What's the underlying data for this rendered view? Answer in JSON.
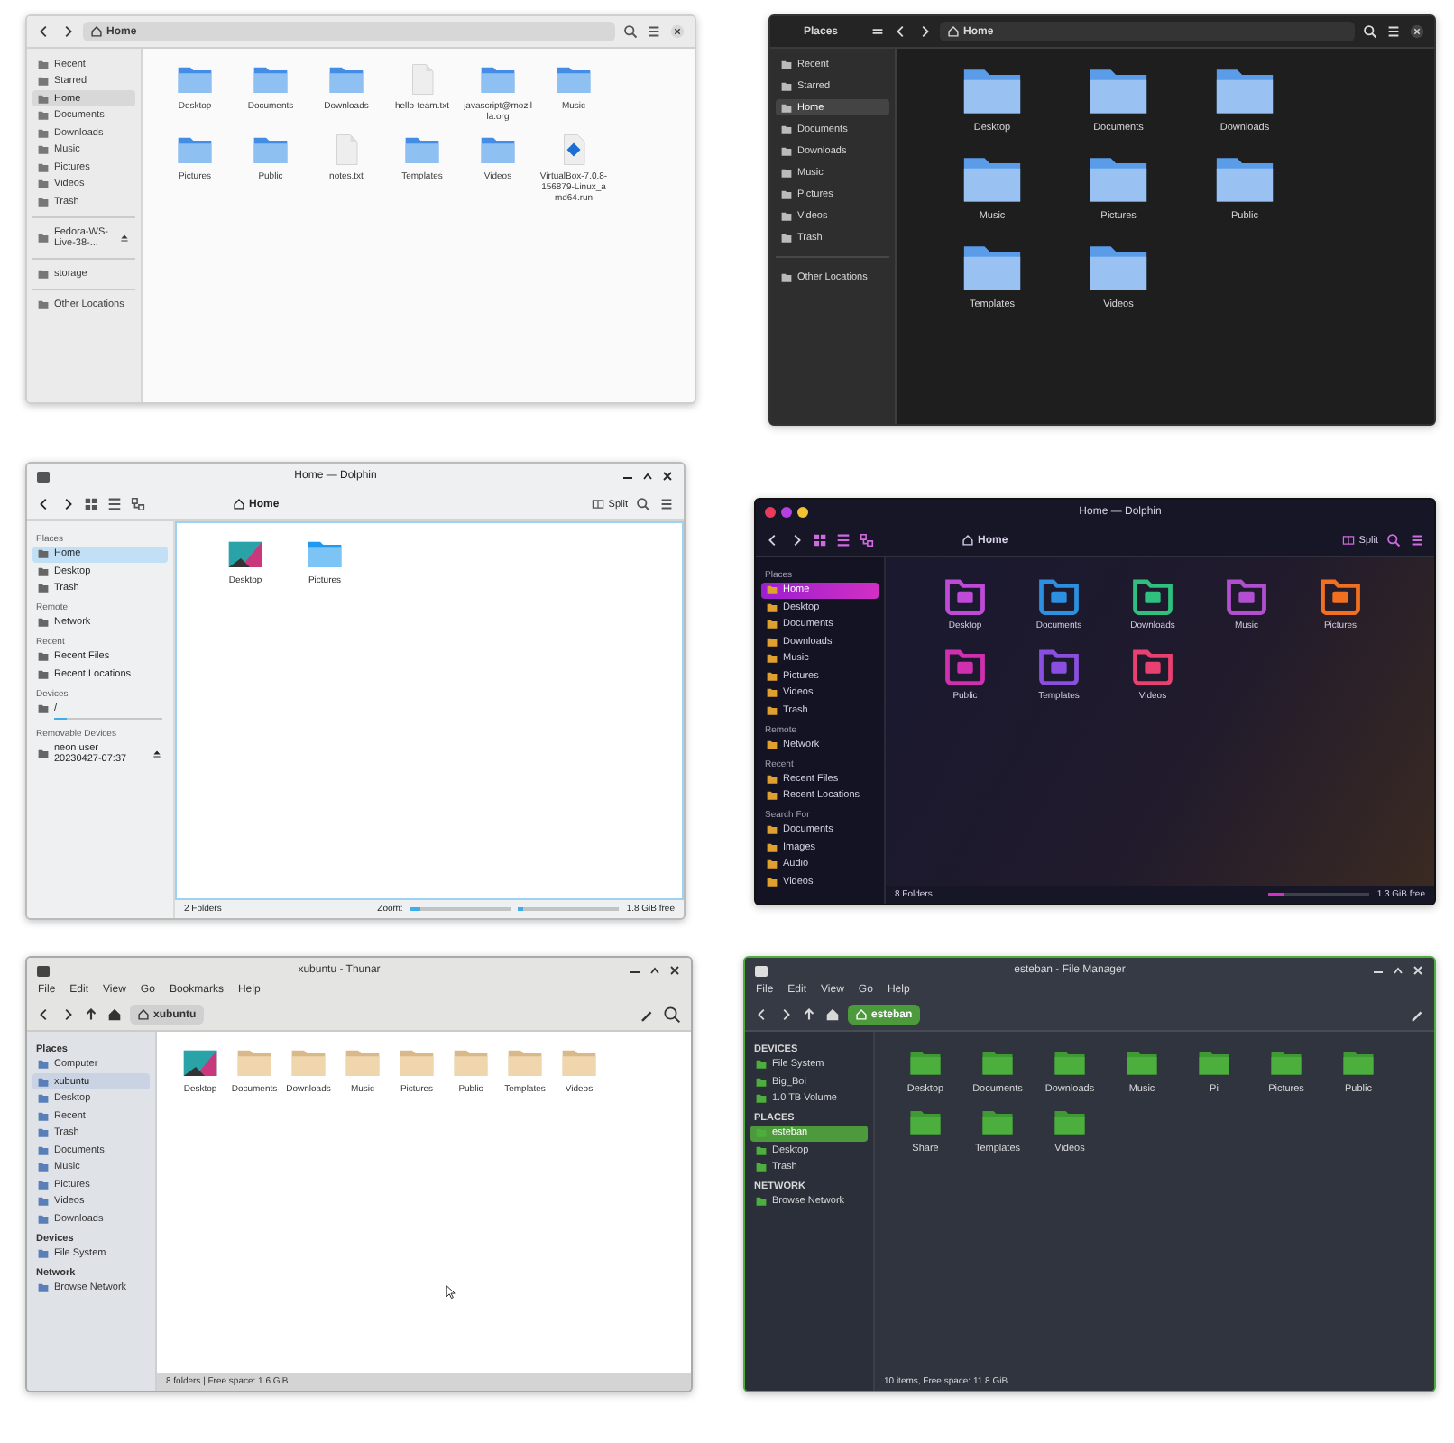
{
  "windows": [
    {
      "kind": "gnome-light",
      "path": "Home",
      "sidebar": [
        {
          "items": [
            {
              "label": "Recent",
              "selected": false
            },
            {
              "label": "Starred",
              "selected": false
            },
            {
              "label": "Home",
              "selected": true
            },
            {
              "label": "Documents",
              "selected": false
            },
            {
              "label": "Downloads",
              "selected": false
            },
            {
              "label": "Music",
              "selected": false
            },
            {
              "label": "Pictures",
              "selected": false
            },
            {
              "label": "Videos",
              "selected": false
            },
            {
              "label": "Trash",
              "selected": false
            }
          ]
        },
        {
          "items": [
            {
              "label": "Fedora-WS-Live-38-...",
              "selected": false,
              "eject": true
            }
          ]
        },
        {
          "items": [
            {
              "label": "storage",
              "selected": false
            }
          ]
        },
        {
          "items": [
            {
              "label": "Other Locations",
              "selected": false
            }
          ]
        }
      ],
      "files": [
        {
          "name": "Desktop",
          "kind": "folder"
        },
        {
          "name": "Documents",
          "kind": "folder"
        },
        {
          "name": "Downloads",
          "kind": "folder"
        },
        {
          "name": "hello-team.txt",
          "kind": "text"
        },
        {
          "name": "javascript@mozilla.org",
          "kind": "folder"
        },
        {
          "name": "Music",
          "kind": "folder"
        },
        {
          "name": "Pictures",
          "kind": "folder"
        },
        {
          "name": "Public",
          "kind": "folder"
        },
        {
          "name": "notes.txt",
          "kind": "text"
        },
        {
          "name": "Templates",
          "kind": "folder"
        },
        {
          "name": "Videos",
          "kind": "folder"
        },
        {
          "name": "VirtualBox-7.0.8-156879-Linux_amd64.run",
          "kind": "package"
        }
      ]
    },
    {
      "kind": "gnome-dark",
      "sidebar_title": "Places",
      "path": "Home",
      "sidebar": [
        {
          "items": [
            {
              "label": "Recent",
              "selected": false
            },
            {
              "label": "Starred",
              "selected": false
            },
            {
              "label": "Home",
              "selected": true
            },
            {
              "label": "Documents",
              "selected": false
            },
            {
              "label": "Downloads",
              "selected": false
            },
            {
              "label": "Music",
              "selected": false
            },
            {
              "label": "Pictures",
              "selected": false
            },
            {
              "label": "Videos",
              "selected": false
            },
            {
              "label": "Trash",
              "selected": false
            }
          ]
        },
        {
          "items": [
            {
              "label": "Other Locations",
              "selected": false
            }
          ]
        }
      ],
      "files": [
        {
          "name": "Desktop",
          "kind": "folder"
        },
        {
          "name": "Documents",
          "kind": "folder"
        },
        {
          "name": "Downloads",
          "kind": "folder"
        },
        {
          "name": "Music",
          "kind": "folder"
        },
        {
          "name": "Pictures",
          "kind": "folder"
        },
        {
          "name": "Public",
          "kind": "folder"
        },
        {
          "name": "Templates",
          "kind": "folder"
        },
        {
          "name": "Videos",
          "kind": "folder"
        }
      ]
    },
    {
      "kind": "dolphin-light",
      "title": "Home — Dolphin",
      "path": "Home",
      "split": "Split",
      "sidebar": [
        {
          "heading": "Places",
          "items": [
            {
              "label": "Home",
              "selected": true
            },
            {
              "label": "Desktop",
              "selected": false
            },
            {
              "label": "Trash",
              "selected": false
            }
          ]
        },
        {
          "heading": "Remote",
          "items": [
            {
              "label": "Network",
              "selected": false
            }
          ]
        },
        {
          "heading": "Recent",
          "items": [
            {
              "label": "Recent Files",
              "selected": false
            },
            {
              "label": "Recent Locations",
              "selected": false
            }
          ]
        },
        {
          "heading": "Devices",
          "items": [
            {
              "label": "/",
              "selected": false,
              "level": 0.12
            }
          ]
        },
        {
          "heading": "Removable Devices",
          "items": [
            {
              "label": "neon user 20230427-07:37",
              "selected": false,
              "eject": true
            }
          ]
        }
      ],
      "files": [
        {
          "name": "Desktop",
          "kind": "image"
        },
        {
          "name": "Pictures",
          "kind": "folder"
        }
      ],
      "status": "2 Folders",
      "zoom": {
        "label": "Zoom:",
        "level": 0.1
      },
      "free_space": {
        "text": "1.8 GiB free",
        "level": 0.05
      }
    },
    {
      "kind": "dolphin-neon",
      "title": "Home — Dolphin",
      "path": "Home",
      "split": "Split",
      "sidebar": [
        {
          "heading": "Places",
          "items": [
            {
              "label": "Home",
              "selected": true
            },
            {
              "label": "Desktop",
              "selected": false
            },
            {
              "label": "Documents",
              "selected": false
            },
            {
              "label": "Downloads",
              "selected": false
            },
            {
              "label": "Music",
              "selected": false
            },
            {
              "label": "Pictures",
              "selected": false
            },
            {
              "label": "Videos",
              "selected": false
            },
            {
              "label": "Trash",
              "selected": false
            }
          ]
        },
        {
          "heading": "Remote",
          "items": [
            {
              "label": "Network",
              "selected": false
            }
          ]
        },
        {
          "heading": "Recent",
          "items": [
            {
              "label": "Recent Files",
              "selected": false
            },
            {
              "label": "Recent Locations",
              "selected": false
            }
          ]
        },
        {
          "heading": "Search For",
          "items": [
            {
              "label": "Documents",
              "selected": false
            },
            {
              "label": "Images",
              "selected": false
            },
            {
              "label": "Audio",
              "selected": false
            },
            {
              "label": "Videos",
              "selected": false
            }
          ]
        }
      ],
      "files": [
        {
          "name": "Desktop",
          "kind": "folder",
          "color": "#c04ad8"
        },
        {
          "name": "Documents",
          "kind": "folder",
          "color": "#2c8fe0"
        },
        {
          "name": "Downloads",
          "kind": "folder",
          "color": "#2fbf7f"
        },
        {
          "name": "Music",
          "kind": "folder",
          "color": "#b24fd0"
        },
        {
          "name": "Pictures",
          "kind": "folder",
          "color": "#f07020"
        },
        {
          "name": "Public",
          "kind": "folder",
          "color": "#d030b0"
        },
        {
          "name": "Templates",
          "kind": "folder",
          "color": "#8a4fe0"
        },
        {
          "name": "Videos",
          "kind": "folder",
          "color": "#e84070"
        }
      ],
      "status": "8 Folders",
      "free_space": {
        "text": "1.3 GiB free",
        "level": 0.15
      }
    },
    {
      "kind": "thunar",
      "title": "xubuntu - Thunar",
      "menu": [
        "File",
        "Edit",
        "View",
        "Go",
        "Bookmarks",
        "Help"
      ],
      "path": "xubuntu",
      "sidebar": [
        {
          "heading": "Places",
          "items": [
            {
              "label": "Computer",
              "selected": false
            },
            {
              "label": "xubuntu",
              "selected": true
            },
            {
              "label": "Desktop",
              "selected": false
            },
            {
              "label": "Recent",
              "selected": false
            },
            {
              "label": "Trash",
              "selected": false
            },
            {
              "label": "Documents",
              "selected": false
            },
            {
              "label": "Music",
              "selected": false
            },
            {
              "label": "Pictures",
              "selected": false
            },
            {
              "label": "Videos",
              "selected": false
            },
            {
              "label": "Downloads",
              "selected": false
            }
          ]
        },
        {
          "heading": "Devices",
          "items": [
            {
              "label": "File System",
              "selected": false
            }
          ]
        },
        {
          "heading": "Network",
          "items": [
            {
              "label": "Browse Network",
              "selected": false
            }
          ]
        }
      ],
      "files": [
        {
          "name": "Desktop",
          "kind": "image"
        },
        {
          "name": "Documents",
          "kind": "folder"
        },
        {
          "name": "Downloads",
          "kind": "folder"
        },
        {
          "name": "Music",
          "kind": "folder"
        },
        {
          "name": "Pictures",
          "kind": "folder"
        },
        {
          "name": "Public",
          "kind": "folder"
        },
        {
          "name": "Templates",
          "kind": "folder"
        },
        {
          "name": "Videos",
          "kind": "folder"
        }
      ],
      "status": "8 folders  |  Free space: 1.6 GiB",
      "cursor": true
    },
    {
      "kind": "mint-green",
      "title": "esteban - File Manager",
      "menu": [
        "File",
        "Edit",
        "View",
        "Go",
        "Help"
      ],
      "path": "esteban",
      "sidebar": [
        {
          "heading": "DEVICES",
          "items": [
            {
              "label": "File System",
              "selected": false
            },
            {
              "label": "Big_Boi",
              "selected": false
            },
            {
              "label": "1.0 TB Volume",
              "selected": false
            }
          ]
        },
        {
          "heading": "PLACES",
          "items": [
            {
              "label": "esteban",
              "selected": true
            },
            {
              "label": "Desktop",
              "selected": false
            },
            {
              "label": "Trash",
              "selected": false
            }
          ]
        },
        {
          "heading": "NETWORK",
          "items": [
            {
              "label": "Browse Network",
              "selected": false
            }
          ]
        }
      ],
      "files": [
        {
          "name": "Desktop",
          "kind": "folder"
        },
        {
          "name": "Documents",
          "kind": "folder"
        },
        {
          "name": "Downloads",
          "kind": "folder"
        },
        {
          "name": "Music",
          "kind": "folder"
        },
        {
          "name": "Pi",
          "kind": "folder"
        },
        {
          "name": "Pictures",
          "kind": "folder"
        },
        {
          "name": "Public",
          "kind": "folder"
        },
        {
          "name": "Share",
          "kind": "folder"
        },
        {
          "name": "Templates",
          "kind": "folder"
        },
        {
          "name": "Videos",
          "kind": "folder"
        }
      ],
      "status": "10 items, Free space: 11.8 GiB"
    }
  ]
}
